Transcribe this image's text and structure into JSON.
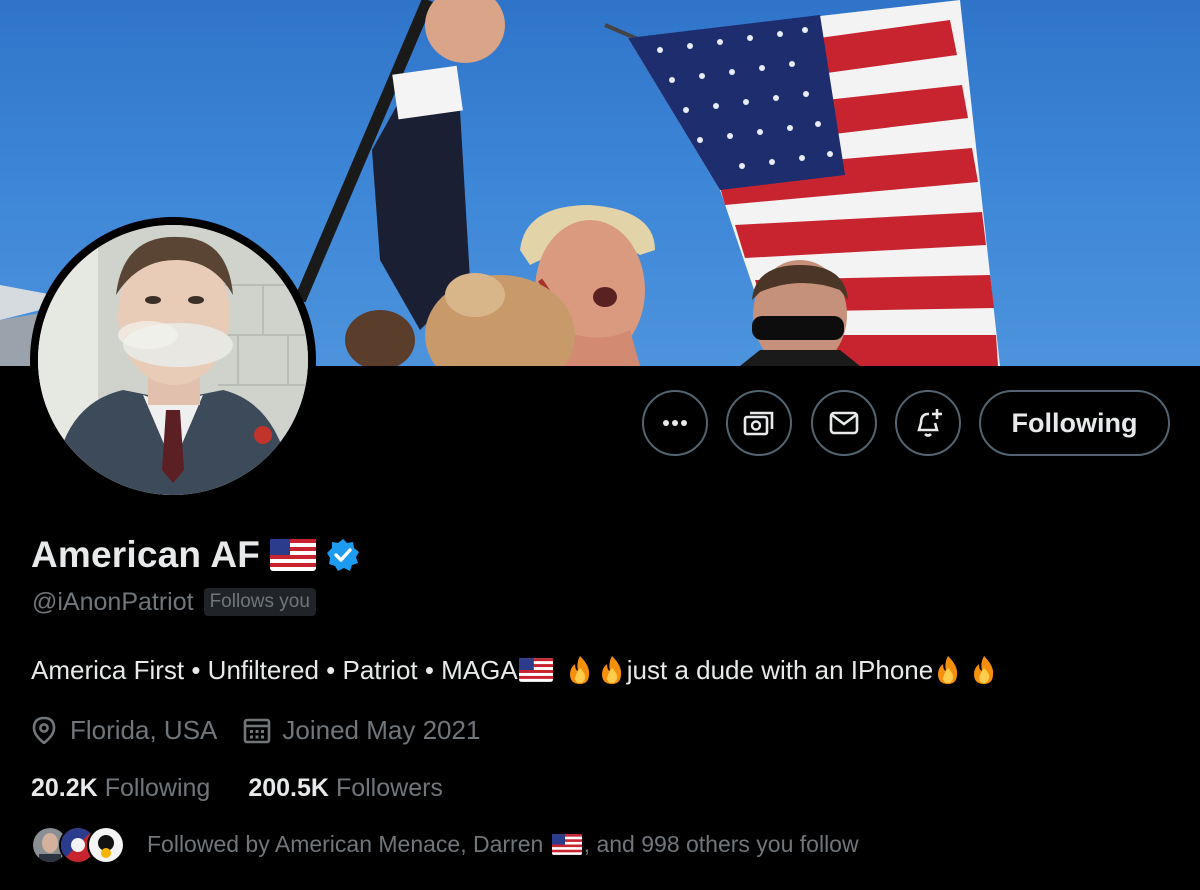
{
  "profile": {
    "display_name": "American AF",
    "handle": "@iAnonPatriot",
    "follows_you_badge": "Follows you",
    "verified": true,
    "verified_color": "#1d9bf0"
  },
  "bio": {
    "text_1": "America First • Unfiltered • Patriot • MAGA",
    "text_2": "just a dude with an IPhone",
    "emoji": [
      "us-flag",
      "fire",
      "fire",
      "fire",
      "fire"
    ]
  },
  "meta": {
    "location": "Florida, USA",
    "joined": "Joined May 2021"
  },
  "stats": {
    "following_count": "20.2K",
    "following_label": "Following",
    "followers_count": "200.5K",
    "followers_label": "Followers"
  },
  "followed_by": {
    "text_1": "Followed by American Menace, Darren ",
    "text_2": ", and 998 others you follow"
  },
  "actions": {
    "more_icon": "more-icon",
    "subscribe_icon": "money-icon",
    "message_icon": "mail-icon",
    "notify_icon": "bell-plus-icon",
    "follow_label": "Following"
  },
  "colors": {
    "background": "#000000",
    "text_primary": "#e7e9ea",
    "text_secondary": "#71767b",
    "border": "#536471"
  }
}
